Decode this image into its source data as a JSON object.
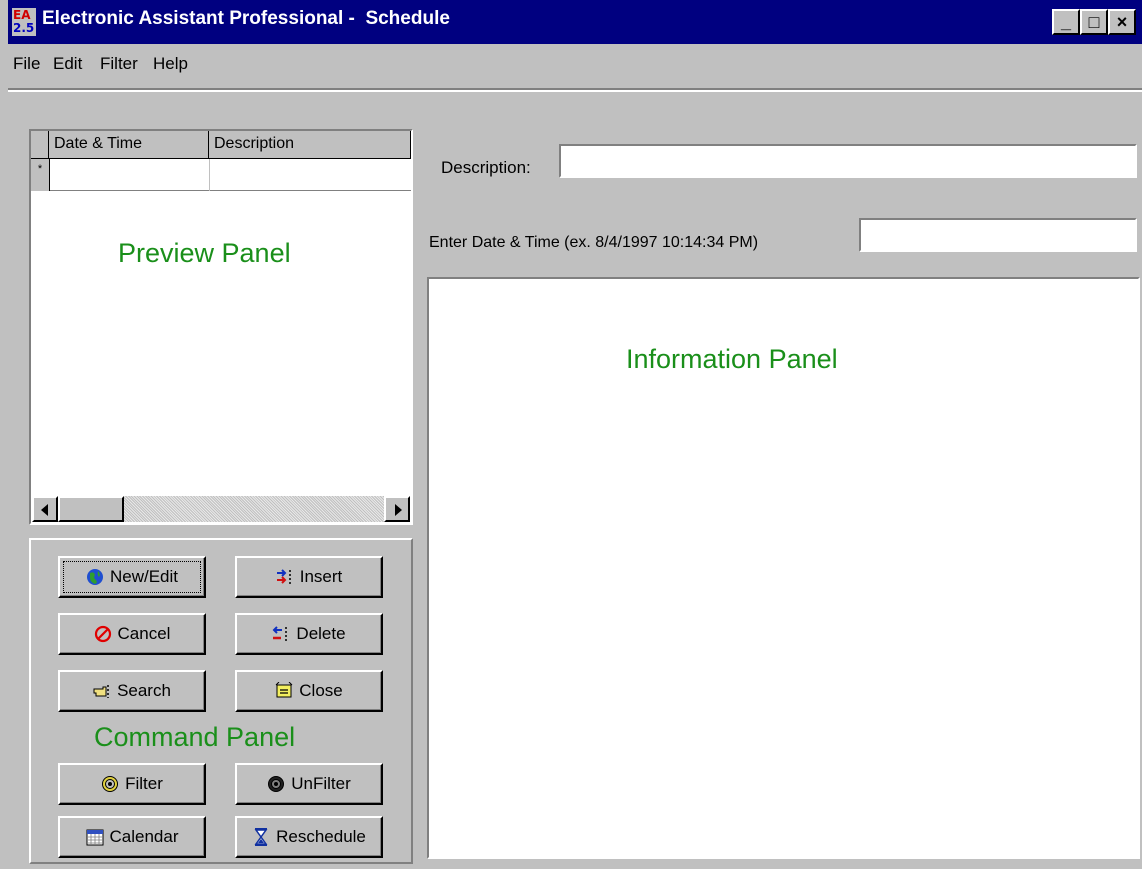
{
  "window": {
    "title": "Electronic Assistant Professional -  Schedule",
    "icon_text_top": "EA",
    "icon_text_bottom": "2.5",
    "controls": {
      "minimize": "_",
      "maximize": "□",
      "close": "×"
    }
  },
  "menu": {
    "items": [
      "File",
      "Edit",
      "Filter",
      "Help"
    ]
  },
  "grid": {
    "columns": [
      "Date & Time",
      "Description"
    ],
    "new_row_marker": "*"
  },
  "labels": {
    "preview_panel": "Preview Panel",
    "command_panel": "Command Panel",
    "information_panel": "Information Panel"
  },
  "form": {
    "description_label": "Description:",
    "description_value": "",
    "date_label": "Enter Date & Time (ex. 8/4/1997 10:14:34 PM)",
    "date_value": ""
  },
  "buttons": {
    "new_edit": "New/Edit",
    "insert": "Insert",
    "cancel": "Cancel",
    "delete": "Delete",
    "search": "Search",
    "close": "Close",
    "filter": "Filter",
    "unfilter": "UnFilter",
    "calendar": "Calendar",
    "reschedule": "Reschedule"
  },
  "icons": {
    "new_edit": "globe-icon",
    "insert": "insert-arrows-icon",
    "cancel": "no-entry-icon",
    "delete": "delete-arrows-icon",
    "search": "pointing-hand-icon",
    "close": "close-door-icon",
    "filter": "filter-gear-icon",
    "unfilter": "unfilter-gear-icon",
    "calendar": "calendar-icon",
    "reschedule": "hourglass-icon"
  },
  "colors": {
    "titlebar": "#000080",
    "panel_label": "#1a8f1a",
    "face": "#c0c0c0"
  }
}
